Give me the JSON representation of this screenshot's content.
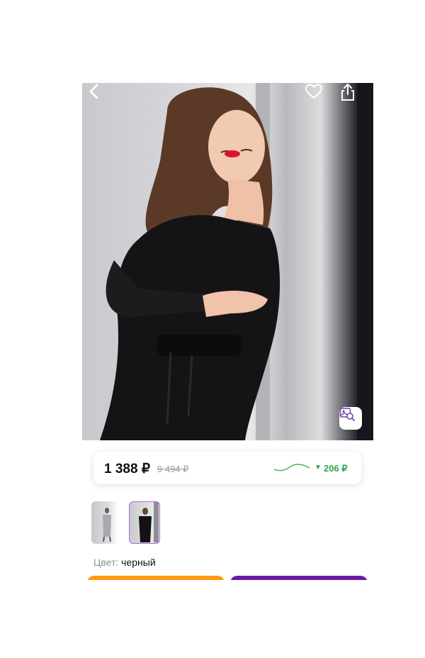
{
  "product": {
    "photo": {
      "description_icon": "product-photo"
    },
    "price": {
      "current": "1 388 ₽",
      "old": "9 494 ₽",
      "drop": "206 ₽",
      "drop_arrow": "▼"
    },
    "color": {
      "label": "Цвет:",
      "value": "черный"
    }
  },
  "icons": {
    "back": "chevron-left-icon",
    "favorite": "heart-icon",
    "share": "share-icon",
    "image_search": "image-search-icon"
  },
  "colors": {
    "cart_button": "#ff9a0f",
    "buy_button": "#6a1aa8",
    "price_drop": "#2ea84a",
    "thumb_selected_border": "#a86ad8"
  }
}
